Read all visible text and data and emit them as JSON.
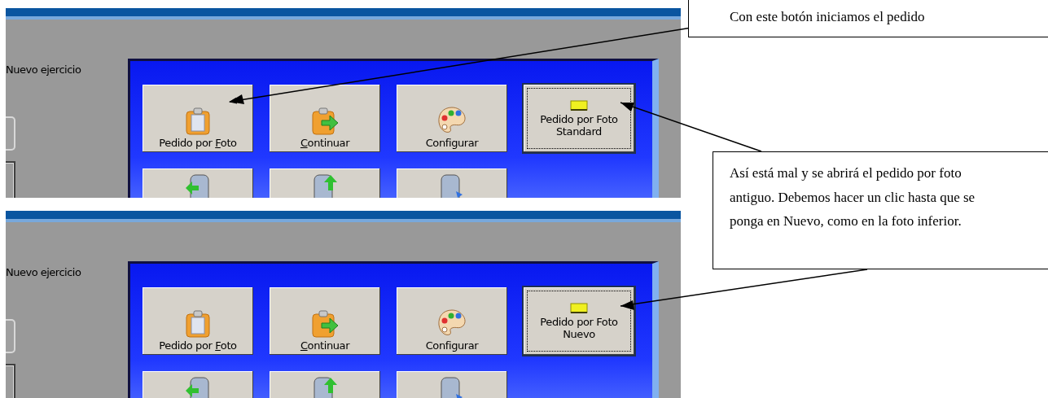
{
  "screenshots": [
    {
      "side_label": "Nuevo ejercicio",
      "buttons": [
        {
          "kind": "clipboard",
          "label": [
            {
              "text": "Pedido por "
            },
            {
              "text": "F",
              "underlined": true
            },
            {
              "text": "oto"
            }
          ],
          "focused": false
        },
        {
          "kind": "clipboard-arrow",
          "label": [
            {
              "text": "C",
              "underlined": true
            },
            {
              "text": "ontinuar"
            }
          ],
          "focused": false
        },
        {
          "kind": "palette",
          "label": [
            {
              "text": "Configurar"
            }
          ],
          "focused": false
        },
        {
          "kind": "note",
          "label": [
            {
              "text": "Pedido por Foto"
            }
          ],
          "second_line": "Standard",
          "focused": true
        }
      ],
      "partial_row": [
        {
          "kind": "device-in"
        },
        {
          "kind": "device-up"
        },
        {
          "kind": "device-out"
        }
      ]
    },
    {
      "side_label": "Nuevo ejercicio",
      "buttons": [
        {
          "kind": "clipboard",
          "label": [
            {
              "text": "Pedido por "
            },
            {
              "text": "F",
              "underlined": true
            },
            {
              "text": "oto"
            }
          ],
          "focused": false
        },
        {
          "kind": "clipboard-arrow",
          "label": [
            {
              "text": "C",
              "underlined": true
            },
            {
              "text": "ontinuar"
            }
          ],
          "focused": false
        },
        {
          "kind": "palette",
          "label": [
            {
              "text": "Configurar"
            }
          ],
          "focused": false
        },
        {
          "kind": "note",
          "label": [
            {
              "text": "Pedido por Foto"
            }
          ],
          "second_line": "Nuevo",
          "focused": true
        }
      ],
      "partial_row": [
        {
          "kind": "device-in"
        },
        {
          "kind": "device-up"
        },
        {
          "kind": "device-out"
        }
      ]
    }
  ],
  "callouts": [
    {
      "text": "Con este botón iniciamos el pedido"
    },
    {
      "text": "Así está mal y se abrirá el pedido por foto antiguo. Debemos hacer un clic hasta que se ponga en Nuevo, como en la foto inferior."
    }
  ]
}
